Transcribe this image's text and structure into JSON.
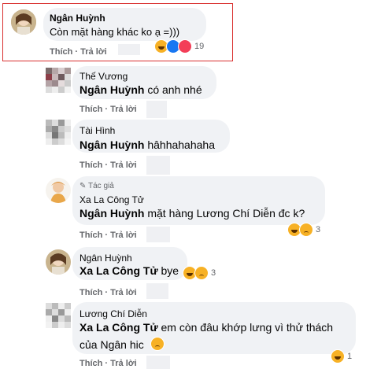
{
  "actions": {
    "like": "Thích",
    "reply": "Trả lời",
    "sep": " · "
  },
  "comments": [
    {
      "name": "Ngân Huỳnh",
      "text": "Còn mặt hàng khác ko ạ =)))",
      "reactions": "19"
    },
    {
      "name": "Thế Vương",
      "mention": "Ngân Huỳnh",
      "text": " có anh nhé"
    },
    {
      "name": "Tài Hình",
      "mention": "Ngân Huỳnh",
      "text": " hâhhahahaha"
    },
    {
      "badge": "Tác giả",
      "name": "Xa La Công Tử",
      "mention": "Ngân Huỳnh",
      "text": " mặt hàng Lương Chí Diễn đc k?",
      "reactions": "3"
    },
    {
      "name": "Ngân Huỳnh",
      "mention": "Xa La Công Tử",
      "text": " bye",
      "reactions": "3"
    },
    {
      "name": "Lương Chí Diễn",
      "mention": "Xa La Công Tử",
      "text": " em còn đâu khớp lưng vì thử thách",
      "text2": "của Ngân hic",
      "reactions": "1"
    }
  ],
  "colors": {
    "highlight_border": "#d9302f",
    "bubble": "#f0f2f5",
    "action_text": "#65676b"
  }
}
